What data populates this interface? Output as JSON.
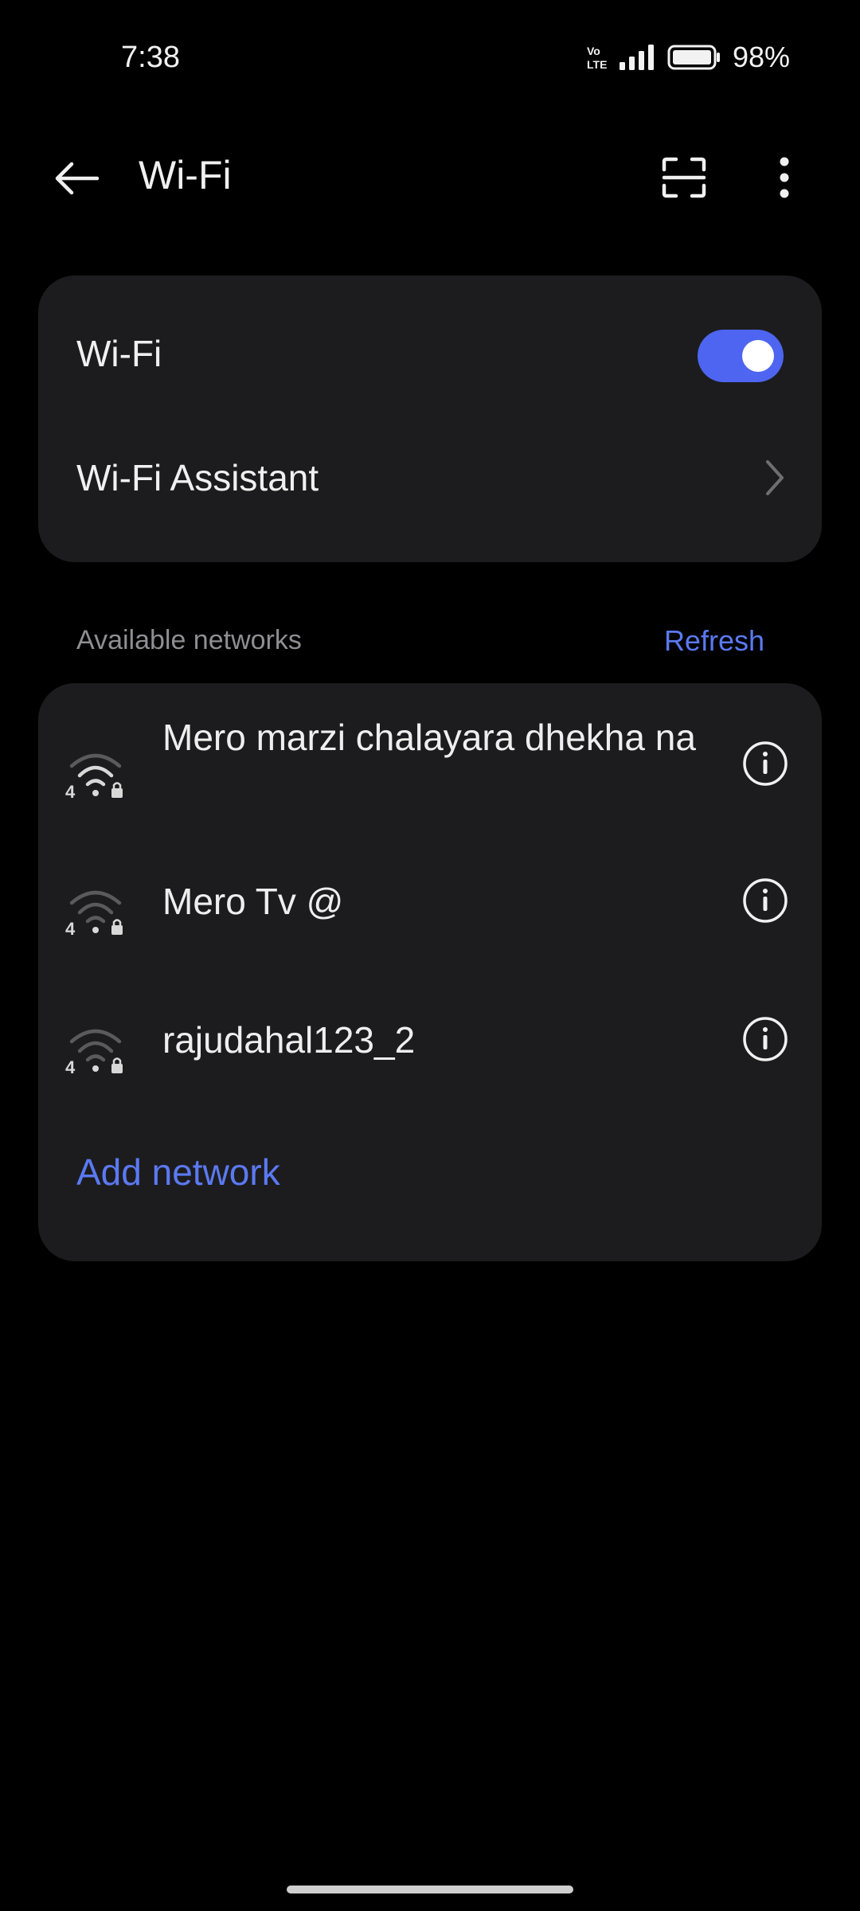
{
  "status_bar": {
    "time": "7:38",
    "network_badge": "Vo LTE",
    "signal_icon": "signal-bars-icon",
    "battery_icon": "battery-icon",
    "battery_percent": "98%"
  },
  "app_bar": {
    "title": "Wi-Fi",
    "back_icon": "arrow-back-icon",
    "scan_icon": "qr-scan-icon",
    "more_icon": "more-vertical-icon"
  },
  "settings": {
    "wifi_label": "Wi-Fi",
    "wifi_enabled": true,
    "assistant_label": "Wi-Fi Assistant"
  },
  "networks": {
    "section_label": "Available networks",
    "refresh_label": "Refresh",
    "items": [
      {
        "name": "Mero marzi chalayara dhekha na",
        "badge": "4",
        "secured": true
      },
      {
        "name": "Mero Tv @",
        "badge": "4",
        "secured": true
      },
      {
        "name": "rajudahal123_2",
        "badge": "4",
        "secured": true
      }
    ],
    "add_label": "Add network"
  },
  "colors": {
    "accent": "#4d65f0",
    "link": "#5b79f2",
    "card": "#1c1c1e",
    "background": "#000000"
  }
}
